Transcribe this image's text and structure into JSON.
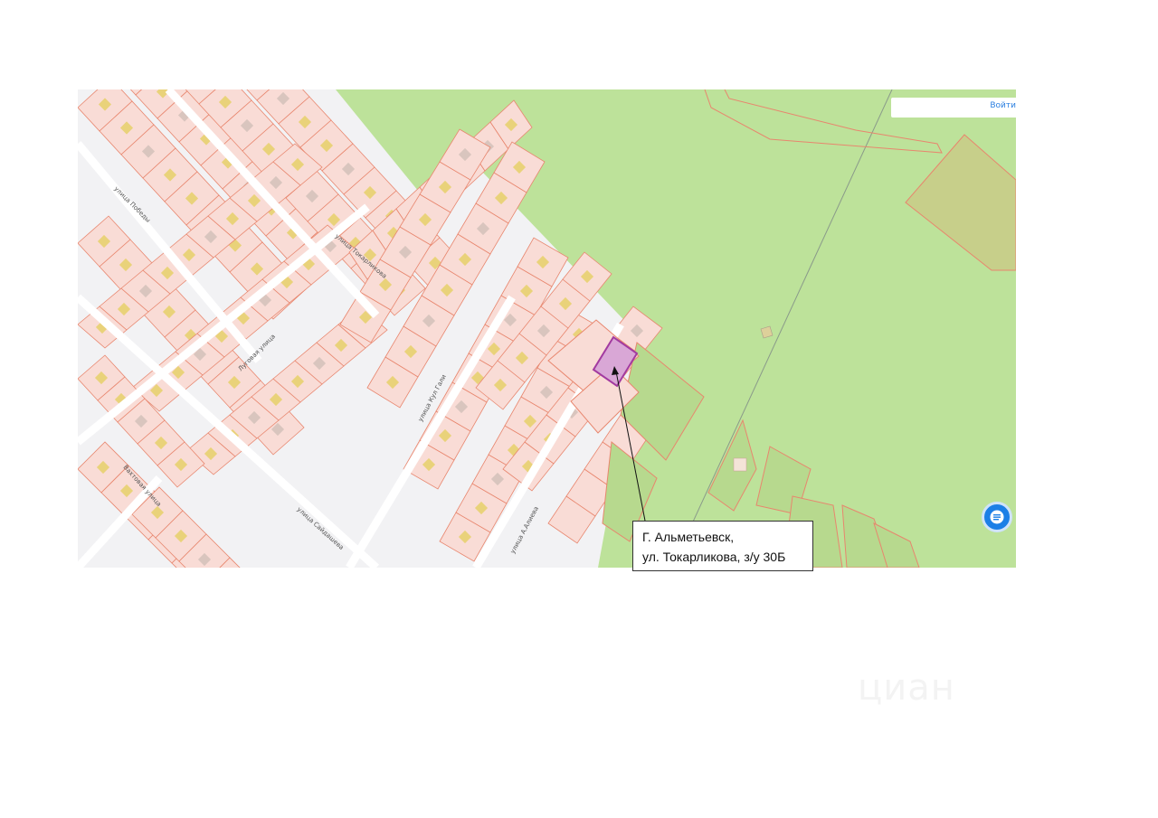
{
  "map": {
    "login_label": "Войти",
    "streets": [
      "улица Победы",
      "улица Токарликова",
      "Луговая улица",
      "улица Кул Гали",
      "улица Сайдашева",
      "Вахтовая улица",
      "улица А.Алиева"
    ],
    "colors": {
      "background": "#f2f2f4",
      "forest": "#bde29a",
      "parcel_fill": "#f9dcd6",
      "parcel_stroke": "#e8866e",
      "building": "#e9d27a",
      "highlight_parcel": "#d9a7d6",
      "highlight_stroke": "#a23aa0",
      "chat_button": "#1c7fe6"
    },
    "chat_icon": "chat-bubble-icon"
  },
  "callout": {
    "line1": "Г. Альметьевск,",
    "line2": "ул. Токарликова, з/у 30Б"
  },
  "watermark": "циан"
}
